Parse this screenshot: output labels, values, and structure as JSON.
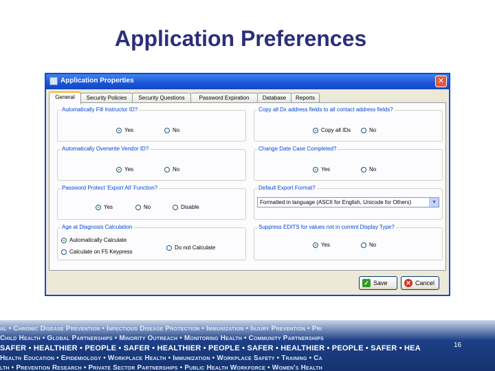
{
  "slide": {
    "title": "Application Preferences",
    "page_number": "16"
  },
  "window": {
    "title": "Application Properties",
    "close_label": "✕"
  },
  "tabs": [
    "General",
    "Security Policies",
    "Security Questions",
    "Password Expiration",
    "Database",
    "Reports"
  ],
  "groups": {
    "autofill_ids": {
      "label": "Automatically Fill Instructor ID?",
      "options": [
        "Yes",
        "No"
      ],
      "selected": "Yes"
    },
    "copy_address": {
      "label": "Copy all Dx address fields to all contact address fields?",
      "options": [
        "Copy all IDs",
        "No"
      ],
      "selected": "Copy all IDs"
    },
    "overwrite_vendor": {
      "label": "Automatically Overwrite Vendor ID?",
      "options": [
        "Yes",
        "No"
      ],
      "selected": "Yes"
    },
    "change_date": {
      "label": "Change Date Case Completed?",
      "options": [
        "Yes",
        "No"
      ],
      "selected": "Yes"
    },
    "password_export": {
      "label": "Password Protect 'Export All' Function?",
      "options": [
        "Yes",
        "No",
        "Disable"
      ],
      "selected": "Yes"
    },
    "default_export": {
      "label": "Default Export Format?",
      "value": "Formatted in language (ASCII for English, Unicode for Others)"
    },
    "age_calc": {
      "label": "Age at Diagnosis Calculation",
      "options": [
        "Automatically Calculate",
        "Calculate on F5 Keypress",
        "Do not Calculate"
      ],
      "selected": "Automatically Calculate"
    },
    "suppress_edits": {
      "label": "Suppress EDITS for values not in current Display Type?",
      "options": [
        "Yes",
        "No"
      ],
      "selected": "Yes"
    }
  },
  "buttons": {
    "save": "Save",
    "cancel": "Cancel"
  },
  "banner_lines": [
    "al • Chronic Disease Prevention • Infectious Disease Protection • Immunization • Injury Prevention • Pri",
    "Child Health • Global Partnerships • Minority Outreach • Monitoring Health • Community Partnerships",
    "SAFER • HEALTHIER • PEOPLE • SAFER • HEALTHIER • PEOPLE • SAFER • HEALTHIER • PEOPLE • SAFER • HEA",
    "Health Education • Epidemiology • Workplace Health • Immunization • Workplace Safety • Training • Ca",
    "lth • Prevention Research • Private Sector Partnerships • Public Health Workforce • Women's Health"
  ]
}
